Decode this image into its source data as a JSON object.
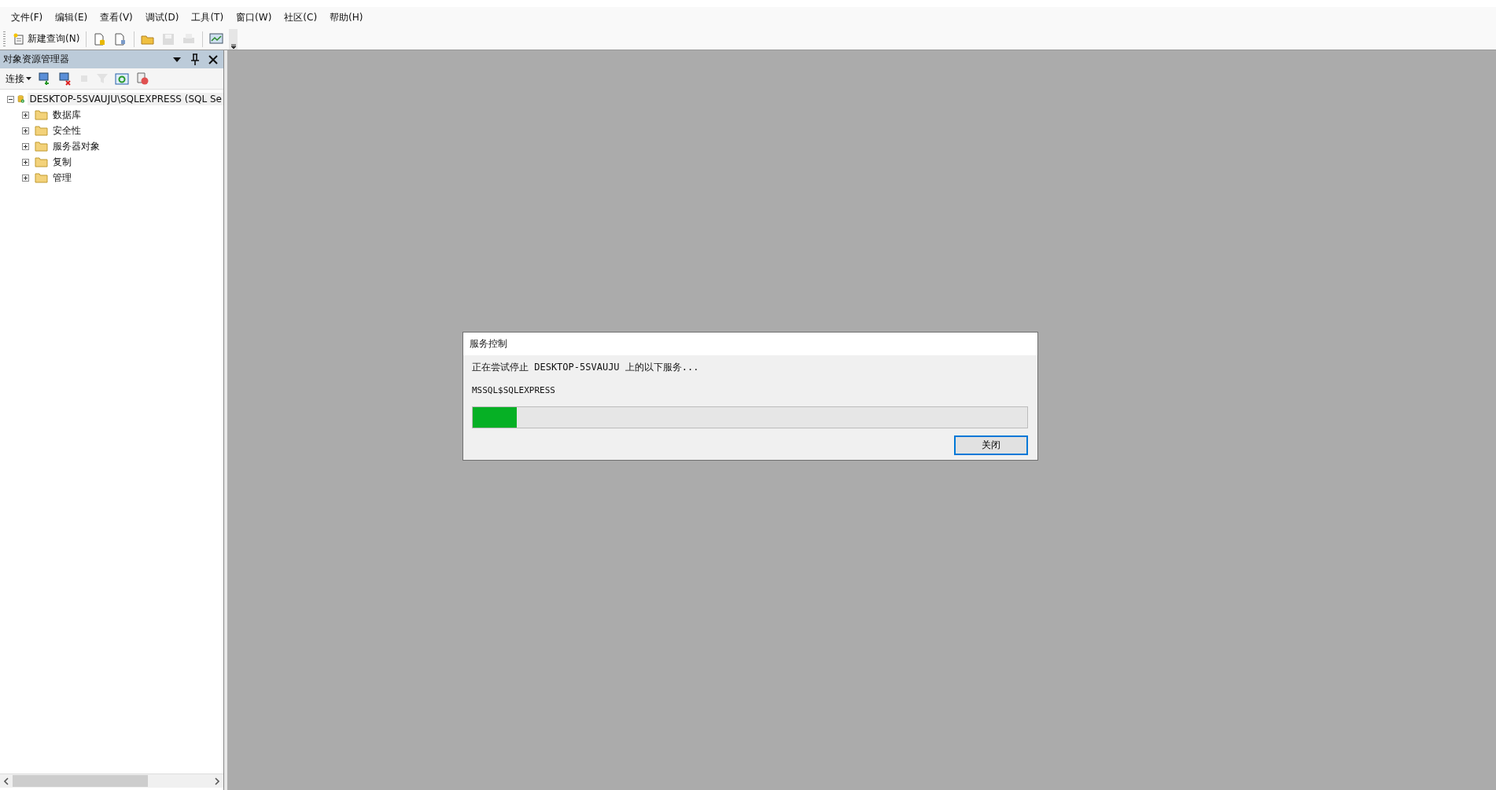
{
  "menu": [
    "文件(F)",
    "编辑(E)",
    "查看(V)",
    "调试(D)",
    "工具(T)",
    "窗口(W)",
    "社区(C)",
    "帮助(H)"
  ],
  "toolbar": {
    "new_query": "新建查询(N)",
    "buttons": [
      {
        "kind": "db-query",
        "disabled": false
      },
      {
        "kind": "doc-query",
        "disabled": false
      },
      {
        "kind": "open",
        "disabled": false
      },
      {
        "kind": "save",
        "disabled": true
      },
      {
        "kind": "print",
        "disabled": true
      },
      {
        "kind": "monitor",
        "disabled": false
      }
    ]
  },
  "object_explorer": {
    "title": "对象资源管理器",
    "connect": "连接",
    "buttons": [
      {
        "kind": "connect",
        "disabled": false
      },
      {
        "kind": "disconnect",
        "disabled": false
      },
      {
        "kind": "stop",
        "disabled": true
      },
      {
        "kind": "filter",
        "disabled": true
      },
      {
        "kind": "refresh",
        "disabled": false
      },
      {
        "kind": "script",
        "disabled": false
      }
    ],
    "tree": [
      {
        "label": "DESKTOP-5SVAUJU\\SQLEXPRESS (SQL Se",
        "expanded": true,
        "selected": true,
        "children": [
          {
            "label": "数据库",
            "expanded": false,
            "selected": false
          },
          {
            "label": "安全性",
            "expanded": false,
            "selected": false
          },
          {
            "label": "服务器对象",
            "expanded": false,
            "selected": false
          },
          {
            "label": "复制",
            "expanded": false,
            "selected": false
          },
          {
            "label": "管理",
            "expanded": false,
            "selected": false
          }
        ]
      }
    ]
  },
  "dialog": {
    "title": "服务控制",
    "message": "正在尝试停止 DESKTOP-5SVAUJU 上的以下服务...",
    "service": "MSSQL$SQLEXPRESS",
    "level": 0.08,
    "button": "关闭"
  }
}
